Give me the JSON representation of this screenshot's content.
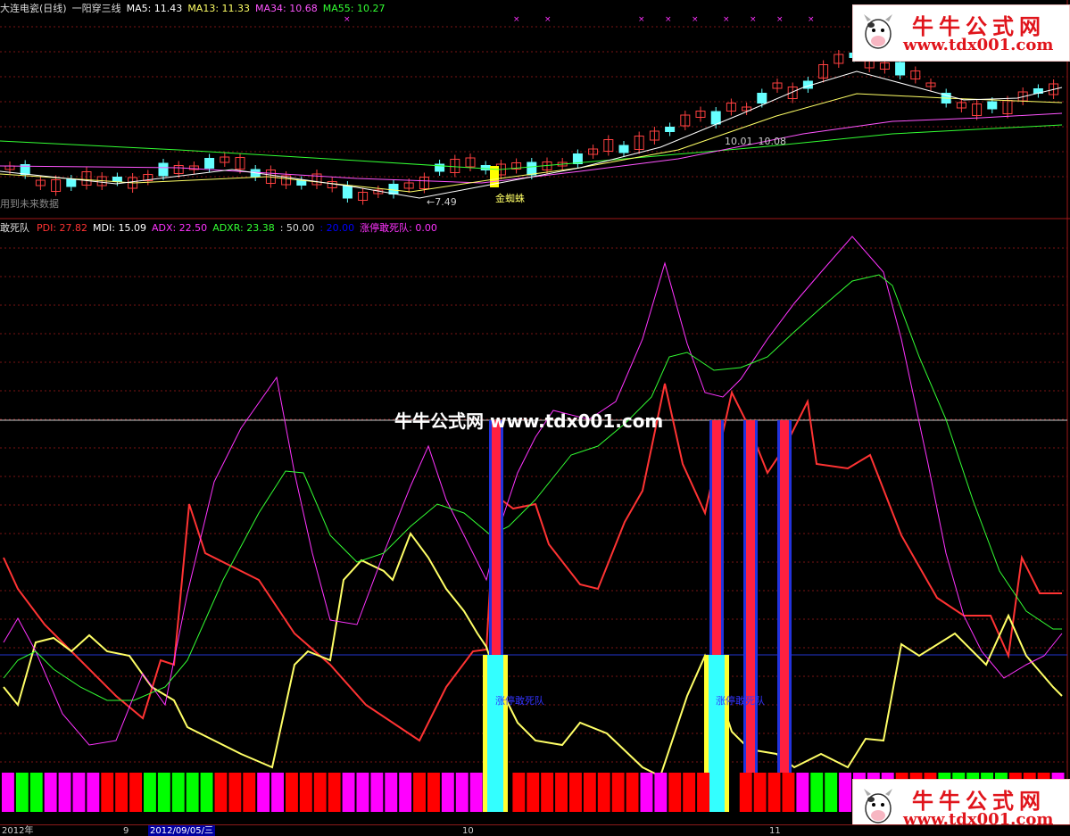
{
  "top_panel": {
    "title": "大连电瓷(日线)",
    "indicator": "一阳穿三线",
    "ma5": "MA5: 11.43",
    "ma13": "MA13: 11.33",
    "ma34": "MA34: 10.68",
    "ma55": "MA55: 10.27",
    "note": "用到未来数据",
    "low_label": "←7.49",
    "golden_label": "金蜘蛛",
    "level_label": "10.01",
    "level_label2": "10.08"
  },
  "bottom_panel": {
    "title": "敢死队",
    "pdi": "PDI: 27.82",
    "mdi": "MDI: 15.09",
    "adx": "ADX: 22.50",
    "adxr": "ADXR: 23.38",
    "ref50": ": 50.00",
    "ref20": ": 20.00",
    "signal": "涨停敢死队: 0.00",
    "bar_label": "涨停敢死队"
  },
  "watermark": {
    "center": "牛牛公式网 www.tdx001.com",
    "logo_cn": "牛牛公式网",
    "logo_url": "www.tdx001.com"
  },
  "axis": {
    "labels": [
      "2012年",
      "9",
      "2012/09/05/三",
      "10",
      "11"
    ]
  },
  "colors": {
    "pdi": "#ff3333",
    "mdi": "#ffffff",
    "adx": "#ff33ff",
    "adxr": "#33ff33",
    "yellow": "#ffff66",
    "up_candle": "#ff4040",
    "down_candle": "#66ffff",
    "ma5": "#ffffff",
    "ma13": "#ffff66",
    "ma34": "#ff55ff",
    "ma55": "#33ff33"
  },
  "chart_data": [
    {
      "type": "candlestick",
      "title": "大连电瓷(日线) 一阳穿三线",
      "series": [
        {
          "name": "MA5",
          "last": 11.43
        },
        {
          "name": "MA13",
          "last": 11.33
        },
        {
          "name": "MA34",
          "last": 10.68
        },
        {
          "name": "MA55",
          "last": 10.27
        }
      ],
      "annotations": [
        "←7.49",
        "金蜘蛛",
        "10.01",
        "10.08",
        "用到未来数据"
      ]
    },
    {
      "type": "line",
      "title": "敢死队",
      "series": [
        {
          "name": "PDI",
          "last": 27.82
        },
        {
          "name": "MDI",
          "last": 15.09
        },
        {
          "name": "ADX",
          "last": 22.5
        },
        {
          "name": "ADXR",
          "last": 23.38
        },
        {
          "name": "涨停敢死队",
          "last": 0.0
        }
      ],
      "reference_lines": [
        50.0,
        20.0
      ],
      "annotations": [
        "涨停敢死队"
      ]
    }
  ]
}
